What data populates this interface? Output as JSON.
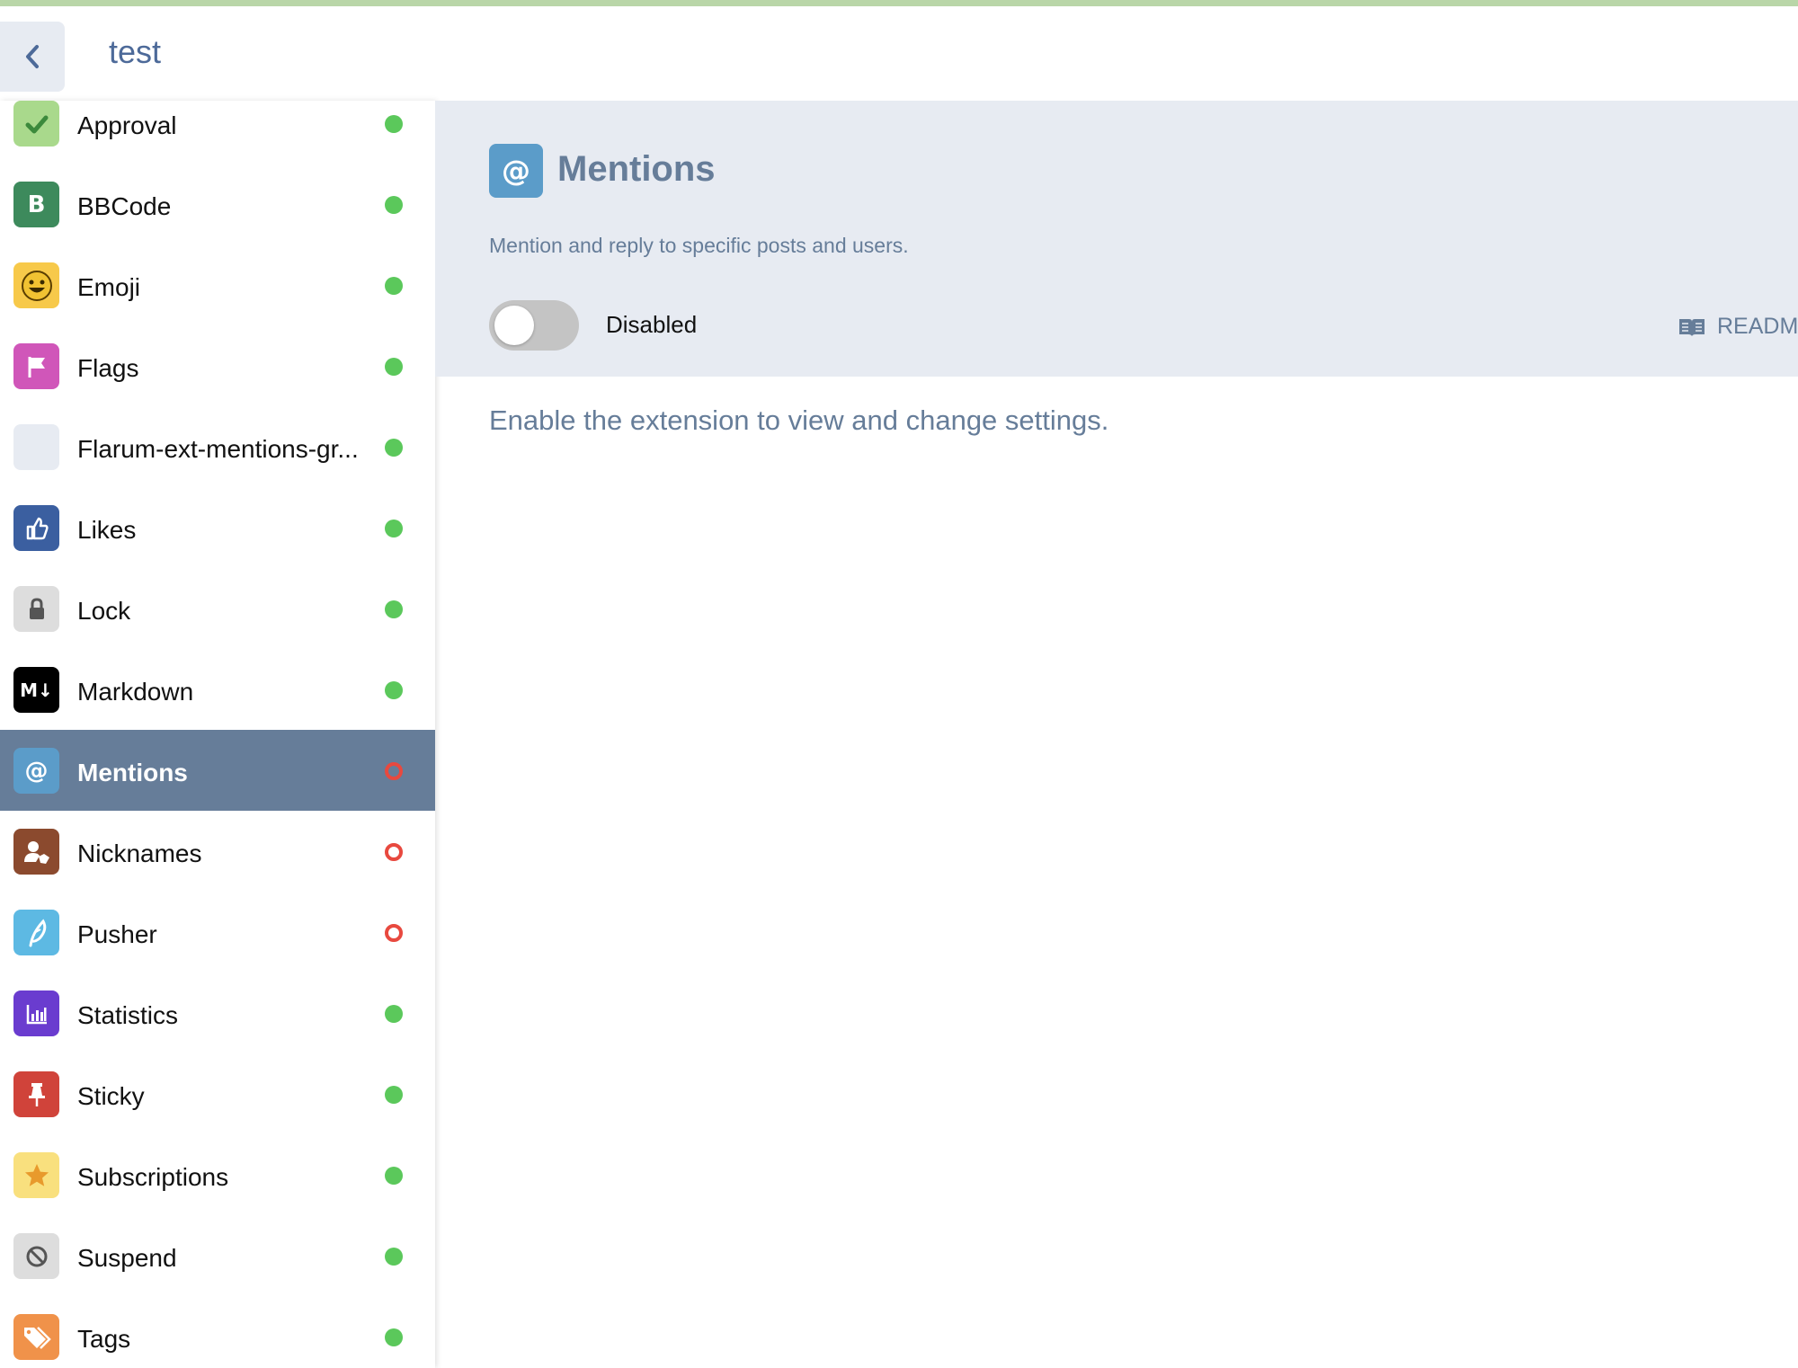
{
  "header": {
    "title": "test",
    "back_icon": "chevron-left-icon"
  },
  "sidebar": {
    "items": [
      {
        "label": "Approval",
        "icon": "check-icon",
        "icon_bg": "#a9d98c",
        "enabled": true
      },
      {
        "label": "BBCode",
        "icon": "bold-b-icon",
        "icon_bg": "#3d8a5c",
        "enabled": true
      },
      {
        "label": "Emoji",
        "icon": "smiley-icon",
        "icon_bg": "#f7c94a",
        "enabled": true
      },
      {
        "label": "Flags",
        "icon": "flag-icon",
        "icon_bg": "#d056b9",
        "enabled": true
      },
      {
        "label": "Flarum-ext-mentions-gr...",
        "icon": "blank-icon",
        "icon_bg": "#e7ebf2",
        "enabled": true
      },
      {
        "label": "Likes",
        "icon": "thumbs-up-icon",
        "icon_bg": "#3b5fa0",
        "enabled": true
      },
      {
        "label": "Lock",
        "icon": "lock-icon",
        "icon_bg": "#dddddd",
        "enabled": true
      },
      {
        "label": "Markdown",
        "icon": "markdown-icon",
        "icon_bg": "#000000",
        "enabled": true
      },
      {
        "label": "Mentions",
        "icon": "at-icon",
        "icon_bg": "#5b9cc9",
        "enabled": false,
        "active": true
      },
      {
        "label": "Nicknames",
        "icon": "user-tag-icon",
        "icon_bg": "#8b4a2e",
        "enabled": false
      },
      {
        "label": "Pusher",
        "icon": "feather-icon",
        "icon_bg": "#5db9e3",
        "enabled": false
      },
      {
        "label": "Statistics",
        "icon": "bar-chart-icon",
        "icon_bg": "#6a3ccf",
        "enabled": true
      },
      {
        "label": "Sticky",
        "icon": "thumbtack-icon",
        "icon_bg": "#d0433a",
        "enabled": true
      },
      {
        "label": "Subscriptions",
        "icon": "star-icon",
        "icon_bg": "#f9e07e",
        "enabled": true
      },
      {
        "label": "Suspend",
        "icon": "ban-icon",
        "icon_bg": "#dddddd",
        "enabled": true
      },
      {
        "label": "Tags",
        "icon": "tags-icon",
        "icon_bg": "#f0924a",
        "enabled": true
      }
    ]
  },
  "extension": {
    "title": "Mentions",
    "icon": "at-icon",
    "description": "Mention and reply to specific posts and users.",
    "toggle_label": "Disabled",
    "toggle_enabled": false,
    "readme_label": "READM",
    "readme_icon": "book-open-icon",
    "notice": "Enable the extension to view and change settings."
  },
  "colors": {
    "accent": "#667d99",
    "status_on": "#5bc85b",
    "status_off": "#e8493f"
  }
}
